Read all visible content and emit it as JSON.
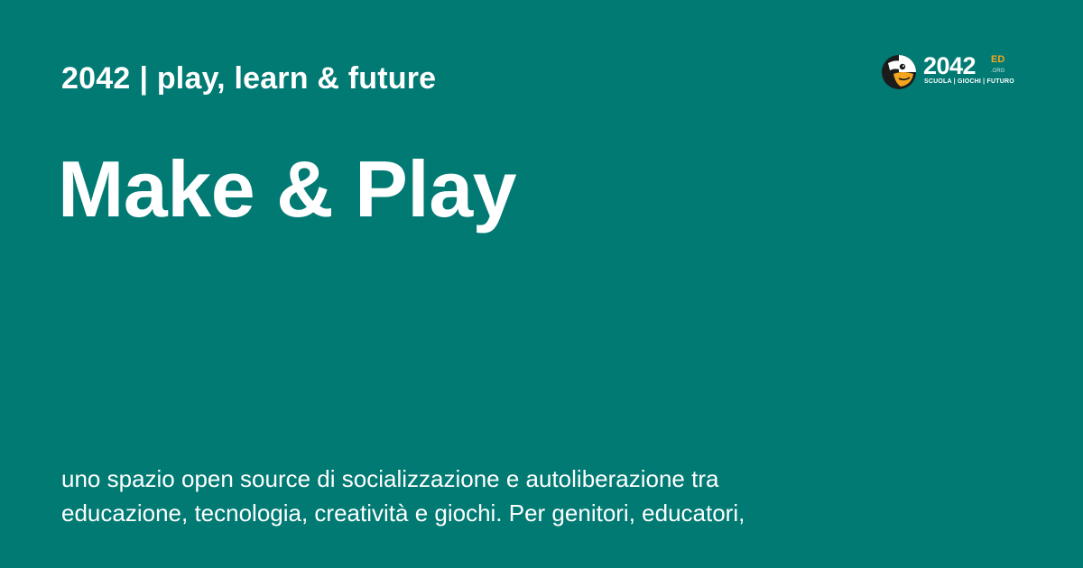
{
  "site": {
    "title_line": "2042\u0001\u0002 | play, learn & future"
  },
  "page": {
    "headline": "Make & Play",
    "description": "uno spazio open source di socializzazione e autoliberazione tra educazione, tecnologia, creatività e giochi. Per genitori, educatori,"
  },
  "logo": {
    "icon": "mascot-head-icon",
    "word": "2042",
    "superscript": "ED",
    "domain_suffix": ".ORG",
    "tagline": "SCUOLA | GIOCHI | FUTURO",
    "accent_color": "#F3A51E"
  },
  "colors": {
    "background": "#007A73",
    "text": "#FFFFFF"
  }
}
